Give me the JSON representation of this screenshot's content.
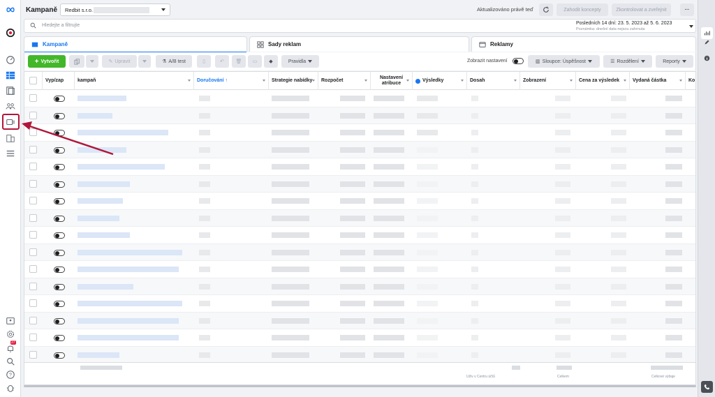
{
  "header": {
    "title": "Kampaně",
    "account_name": "Redbit s.r.o.",
    "updated_text": "Aktualizováno právě teď",
    "discard_label": "Zahodit koncepty",
    "review_label": "Zkontrolovat a zveřejnit",
    "more_label": "···"
  },
  "search": {
    "placeholder": "Hledejte a filtrujte"
  },
  "date_range": {
    "label": "Posledních 14 dní: 23. 5. 2023 až 5. 6. 2023",
    "note": "Poznámka: dnešní data nejsou zahrnuta"
  },
  "tabs": [
    {
      "label": "Kampaně",
      "active": true
    },
    {
      "label": "Sady reklam",
      "active": false
    },
    {
      "label": "Reklamy",
      "active": false
    }
  ],
  "toolbar": {
    "create_label": "Vytvořit",
    "edit_label": "Upravit",
    "ab_test_label": "A/B test",
    "rules_label": "Pravidla",
    "show_settings_label": "Zobrazit nastavení",
    "columns_label": "Sloupce: Úspěšnost",
    "breakdown_label": "Rozdělení",
    "reports_label": "Reporty"
  },
  "table": {
    "columns": [
      "Vyp/zap",
      "kampaň",
      "Doručování ↑",
      "Strategie nabídky",
      "Rozpočet",
      "Nastavení atribuce",
      "Výsledky",
      "Dosah",
      "Zobrazení",
      "Cena za výsledek",
      "Vydaná částka",
      "Ko"
    ],
    "row_count": 16,
    "footer_labels": {
      "results": "Uživ v Centru účtů",
      "impressions": "Celkem",
      "spent": "Celkové výdaje"
    }
  },
  "colors": {
    "accent": "#1877f2",
    "create": "#42b72a",
    "highlight": "#b0173a"
  },
  "icons": {
    "leftbar": [
      "meta-logo-icon",
      "ads-manager-icon",
      "dashboard-icon",
      "campaigns-grid-icon",
      "pages-icon",
      "audiences-icon",
      "ads-icon",
      "billing-icon",
      "menu-icon",
      "id-card-icon",
      "settings-icon",
      "notifications-icon",
      "search-icon",
      "help-icon",
      "bug-icon"
    ],
    "rightbar": [
      "chart-icon",
      "pencil-icon",
      "info-icon",
      "phone-icon"
    ]
  },
  "notifications_badge": "27"
}
